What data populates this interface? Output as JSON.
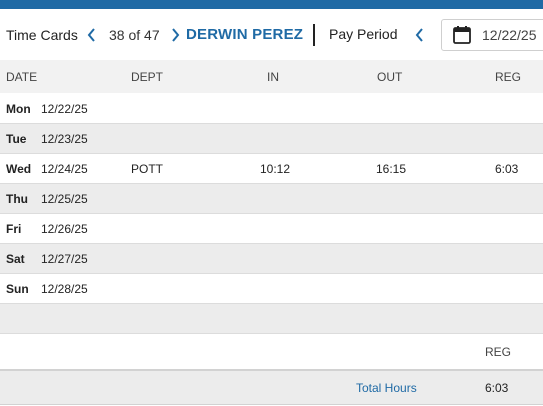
{
  "header": {
    "title": "Time Cards",
    "counter": "38 of 47",
    "employee": "DERWIN PEREZ",
    "pay_period_label": "Pay Period",
    "date_value": "12/22/25"
  },
  "columns": {
    "date": "DATE",
    "dept": "DEPT",
    "in": "IN",
    "out": "OUT",
    "reg": "REG"
  },
  "rows": [
    {
      "day": "Mon",
      "date": "12/22/25",
      "dept": "",
      "in": "",
      "out": "",
      "reg": ""
    },
    {
      "day": "Tue",
      "date": "12/23/25",
      "dept": "",
      "in": "",
      "out": "",
      "reg": ""
    },
    {
      "day": "Wed",
      "date": "12/24/25",
      "dept": "POTT",
      "in": "10:12",
      "out": "16:15",
      "reg": "6:03"
    },
    {
      "day": "Thu",
      "date": "12/25/25",
      "dept": "",
      "in": "",
      "out": "",
      "reg": ""
    },
    {
      "day": "Fri",
      "date": "12/26/25",
      "dept": "",
      "in": "",
      "out": "",
      "reg": ""
    },
    {
      "day": "Sat",
      "date": "12/27/25",
      "dept": "",
      "in": "",
      "out": "",
      "reg": ""
    },
    {
      "day": "Sun",
      "date": "12/28/25",
      "dept": "",
      "in": "",
      "out": "",
      "reg": ""
    }
  ],
  "summary": {
    "reg_header": "REG",
    "total_label": "Total Hours",
    "total_reg": "6:03"
  },
  "colors": {
    "accent": "#1f6aa5",
    "row_alt": "#ececec",
    "header_bg": "#f2f2f2"
  },
  "icons": {
    "prev": "chevron-left-icon",
    "next": "chevron-right-icon",
    "calendar": "calendar-icon"
  }
}
